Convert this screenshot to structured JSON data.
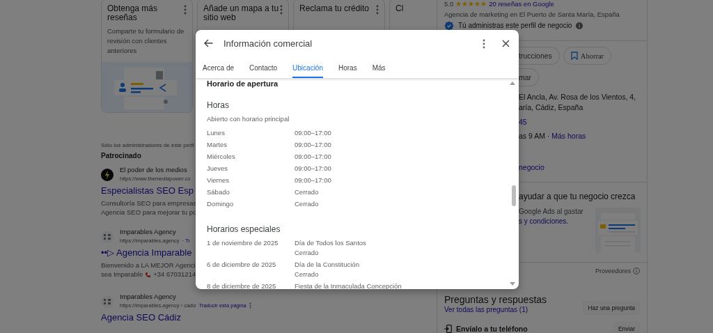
{
  "background": {
    "cards": [
      {
        "title": "Obtenga más reseñas",
        "description": "Comparte tu formulario de revisión con clientes anteriores",
        "menu": true,
        "illustration": true
      },
      {
        "title": "Añade un mapa a tu sitio web",
        "menu": true,
        "illustration": false
      },
      {
        "title": "Reclama tu crédito",
        "menu": true,
        "illustration": false
      },
      {
        "title": "Cl",
        "menu": false,
        "illustration": false
      }
    ],
    "admin_note": "Sólo los administradores de este perfi",
    "sponsored_label": "Patrocinado",
    "results": [
      {
        "kind": "bolt",
        "site": "El poder de los medios",
        "url": "https://www.themediapower.co",
        "title": "Especialistas SEO Esp",
        "snippet": [
          "Consultoría SEO para empresas",
          "Agencia SEO para mejorar tu po"
        ]
      },
      {
        "kind": "emblem",
        "site": "Imparables Agency",
        "url": "https://imparables.agency",
        "url_link": "· Tr",
        "title": "••▷ Agencia Imparable",
        "snippet": [
          "Bienvenido a LA MEJOR Agenci"
        ],
        "phone_line": {
          "text": "sea Imparable",
          "phone": "+34 67031214"
        }
      },
      {
        "kind": "emblem",
        "site": "Imparables Agency",
        "url": "https://imparables.agency › cadiz",
        "url_link": "Traducir esta página",
        "menu": true,
        "title": "Agencia SEO Cádiz"
      }
    ],
    "panel": {
      "rating": {
        "score": "5.0",
        "stars": 5,
        "reviews": "20 reseñas en Google"
      },
      "category": "Agencia de marketing en El Puerto de Santa María, España",
      "owner_note": "Tú administras este perfil de negocio",
      "action_rows": [
        [
          {
            "label": "trucciones",
            "kind": "cut"
          },
          {
            "label": "Ahorrar",
            "kind": "bookmark"
          }
        ],
        [
          {
            "label": "mar",
            "kind": "cut"
          }
        ]
      ],
      "address_lines": [
        "El Ancla, Av. Rosa de los Vientos, 4,",
        "aría, Cádiz, España"
      ],
      "phone": "45",
      "hours": {
        "text": "as 9 AM ·",
        "link": "Más horas"
      },
      "manage_link": "negocio",
      "promo": {
        "title": "ayudar a que tu negocio crezca",
        "text": "Google Ads al gastar",
        "terms_link": "s y condiciones."
      },
      "providers": "Proveedores",
      "qa": {
        "title": "Preguntas y respuestas",
        "link": "Ver todas las preguntas",
        "count": "(1)",
        "button": "Haz una pregunta"
      },
      "send": {
        "label": "Envíalo a tu teléfono",
        "button": "Enviar"
      }
    }
  },
  "dialog": {
    "title": "Información comercial",
    "tabs": [
      {
        "label": "Acerca de",
        "selected": false
      },
      {
        "label": "Contacto",
        "selected": false
      },
      {
        "label": "Ubicación",
        "selected": true
      },
      {
        "label": "Horas",
        "selected": false
      },
      {
        "label": "Más",
        "selected": false
      }
    ],
    "section_title": "Horario de apertura",
    "hours_heading": "Horas",
    "hours_note": "Abierto con horario principal",
    "days": [
      {
        "day": "Lunes",
        "hours": "09:00–17:00"
      },
      {
        "day": "Martes",
        "hours": "09:00–17:00"
      },
      {
        "day": "Miércoles",
        "hours": "09:00–17:00"
      },
      {
        "day": "Jueves",
        "hours": "09:00–17:00"
      },
      {
        "day": "Viernes",
        "hours": "09:00–17:00"
      },
      {
        "day": "Sábado",
        "hours": "Cerrado"
      },
      {
        "day": "Domingo",
        "hours": "Cerrado"
      }
    ],
    "special_heading": "Horarios especiales",
    "special_days": [
      {
        "date": "1 de noviembre de 2025",
        "name": "Día de Todos los Santos",
        "status": "Cerrado"
      },
      {
        "date": "6 de diciembre de 2025",
        "name": "Día de la Constitución",
        "status": "Cerrado"
      },
      {
        "date": "8 de diciembre de 2025",
        "name": "Fiesta de la Inmaculada Concepción"
      }
    ]
  }
}
